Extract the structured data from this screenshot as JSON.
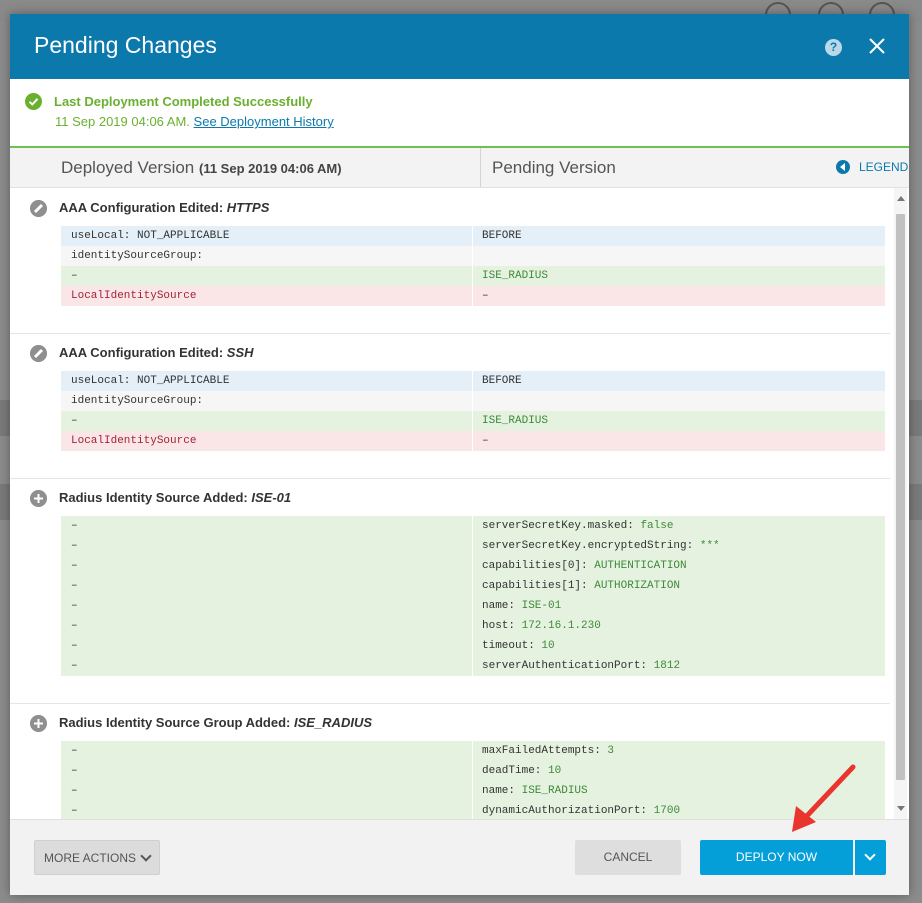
{
  "modal": {
    "title": "Pending Changes",
    "help_icon": "question-icon",
    "close_icon": "close-icon"
  },
  "status": {
    "title": "Last Deployment Completed Successfully",
    "date": "11 Sep 2019 04:06 AM.",
    "history_link": "See Deployment History"
  },
  "columns": {
    "deployed_label": "Deployed Version",
    "deployed_date": "(11 Sep 2019 04:06 AM)",
    "pending_label": "Pending Version",
    "legend_label": "LEGEND"
  },
  "sections": [
    {
      "icon": "edit-icon",
      "title_prefix": "AAA Configuration Edited: ",
      "title_italic": "HTTPS",
      "rows": [
        {
          "style": "blue",
          "left": "useLocal: NOT_APPLICABLE",
          "right": "BEFORE"
        },
        {
          "style": "grey",
          "left": "identitySourceGroup:",
          "right": ""
        },
        {
          "style": "green",
          "left": "–",
          "right": "ISE_RADIUS"
        },
        {
          "style": "red",
          "left": "LocalIdentitySource",
          "right": "–"
        }
      ]
    },
    {
      "icon": "edit-icon",
      "title_prefix": "AAA Configuration Edited: ",
      "title_italic": "SSH",
      "rows": [
        {
          "style": "blue",
          "left": "useLocal: NOT_APPLICABLE",
          "right": "BEFORE"
        },
        {
          "style": "grey",
          "left": "identitySourceGroup:",
          "right": ""
        },
        {
          "style": "green",
          "left": "–",
          "right": "ISE_RADIUS"
        },
        {
          "style": "red",
          "left": "LocalIdentitySource",
          "right": "–"
        }
      ]
    },
    {
      "icon": "plus-icon",
      "title_prefix": "Radius Identity Source Added: ",
      "title_italic": "ISE-01",
      "rows": [
        {
          "style": "green",
          "left": "–",
          "right_key": "serverSecretKey.masked: ",
          "right_val": "false"
        },
        {
          "style": "green",
          "left": "–",
          "right_key": "serverSecretKey.encryptedString: ",
          "right_val": "***"
        },
        {
          "style": "green",
          "left": "–",
          "right_key": "capabilities[0]: ",
          "right_val": "AUTHENTICATION"
        },
        {
          "style": "green",
          "left": "–",
          "right_key": "capabilities[1]: ",
          "right_val": "AUTHORIZATION"
        },
        {
          "style": "green",
          "left": "–",
          "right_key": "name: ",
          "right_val": "ISE-01"
        },
        {
          "style": "green",
          "left": "–",
          "right_key": "host: ",
          "right_val": "172.16.1.230"
        },
        {
          "style": "green",
          "left": "–",
          "right_key": "timeout: ",
          "right_val": "10"
        },
        {
          "style": "green",
          "left": "–",
          "right_key": "serverAuthenticationPort: ",
          "right_val": "1812"
        }
      ]
    },
    {
      "icon": "plus-icon",
      "title_prefix": "Radius Identity Source Group Added: ",
      "title_italic": "ISE_RADIUS",
      "rows": [
        {
          "style": "green",
          "left": "–",
          "right_key": "maxFailedAttempts: ",
          "right_val": "3"
        },
        {
          "style": "green",
          "left": "–",
          "right_key": "deadTime: ",
          "right_val": "10"
        },
        {
          "style": "green",
          "left": "–",
          "right_key": "name: ",
          "right_val": "ISE_RADIUS"
        },
        {
          "style": "green",
          "left": "–",
          "right_key": "dynamicAuthorizationPort: ",
          "right_val": "1700"
        }
      ]
    }
  ],
  "footer": {
    "more_actions": "MORE ACTIONS",
    "cancel": "CANCEL",
    "deploy_now": "DEPLOY NOW"
  },
  "colors": {
    "header_blue": "#0c79ad",
    "success_green": "#6ab02f",
    "deploy_blue": "#049fd9",
    "annotation_red": "#e8352e"
  }
}
